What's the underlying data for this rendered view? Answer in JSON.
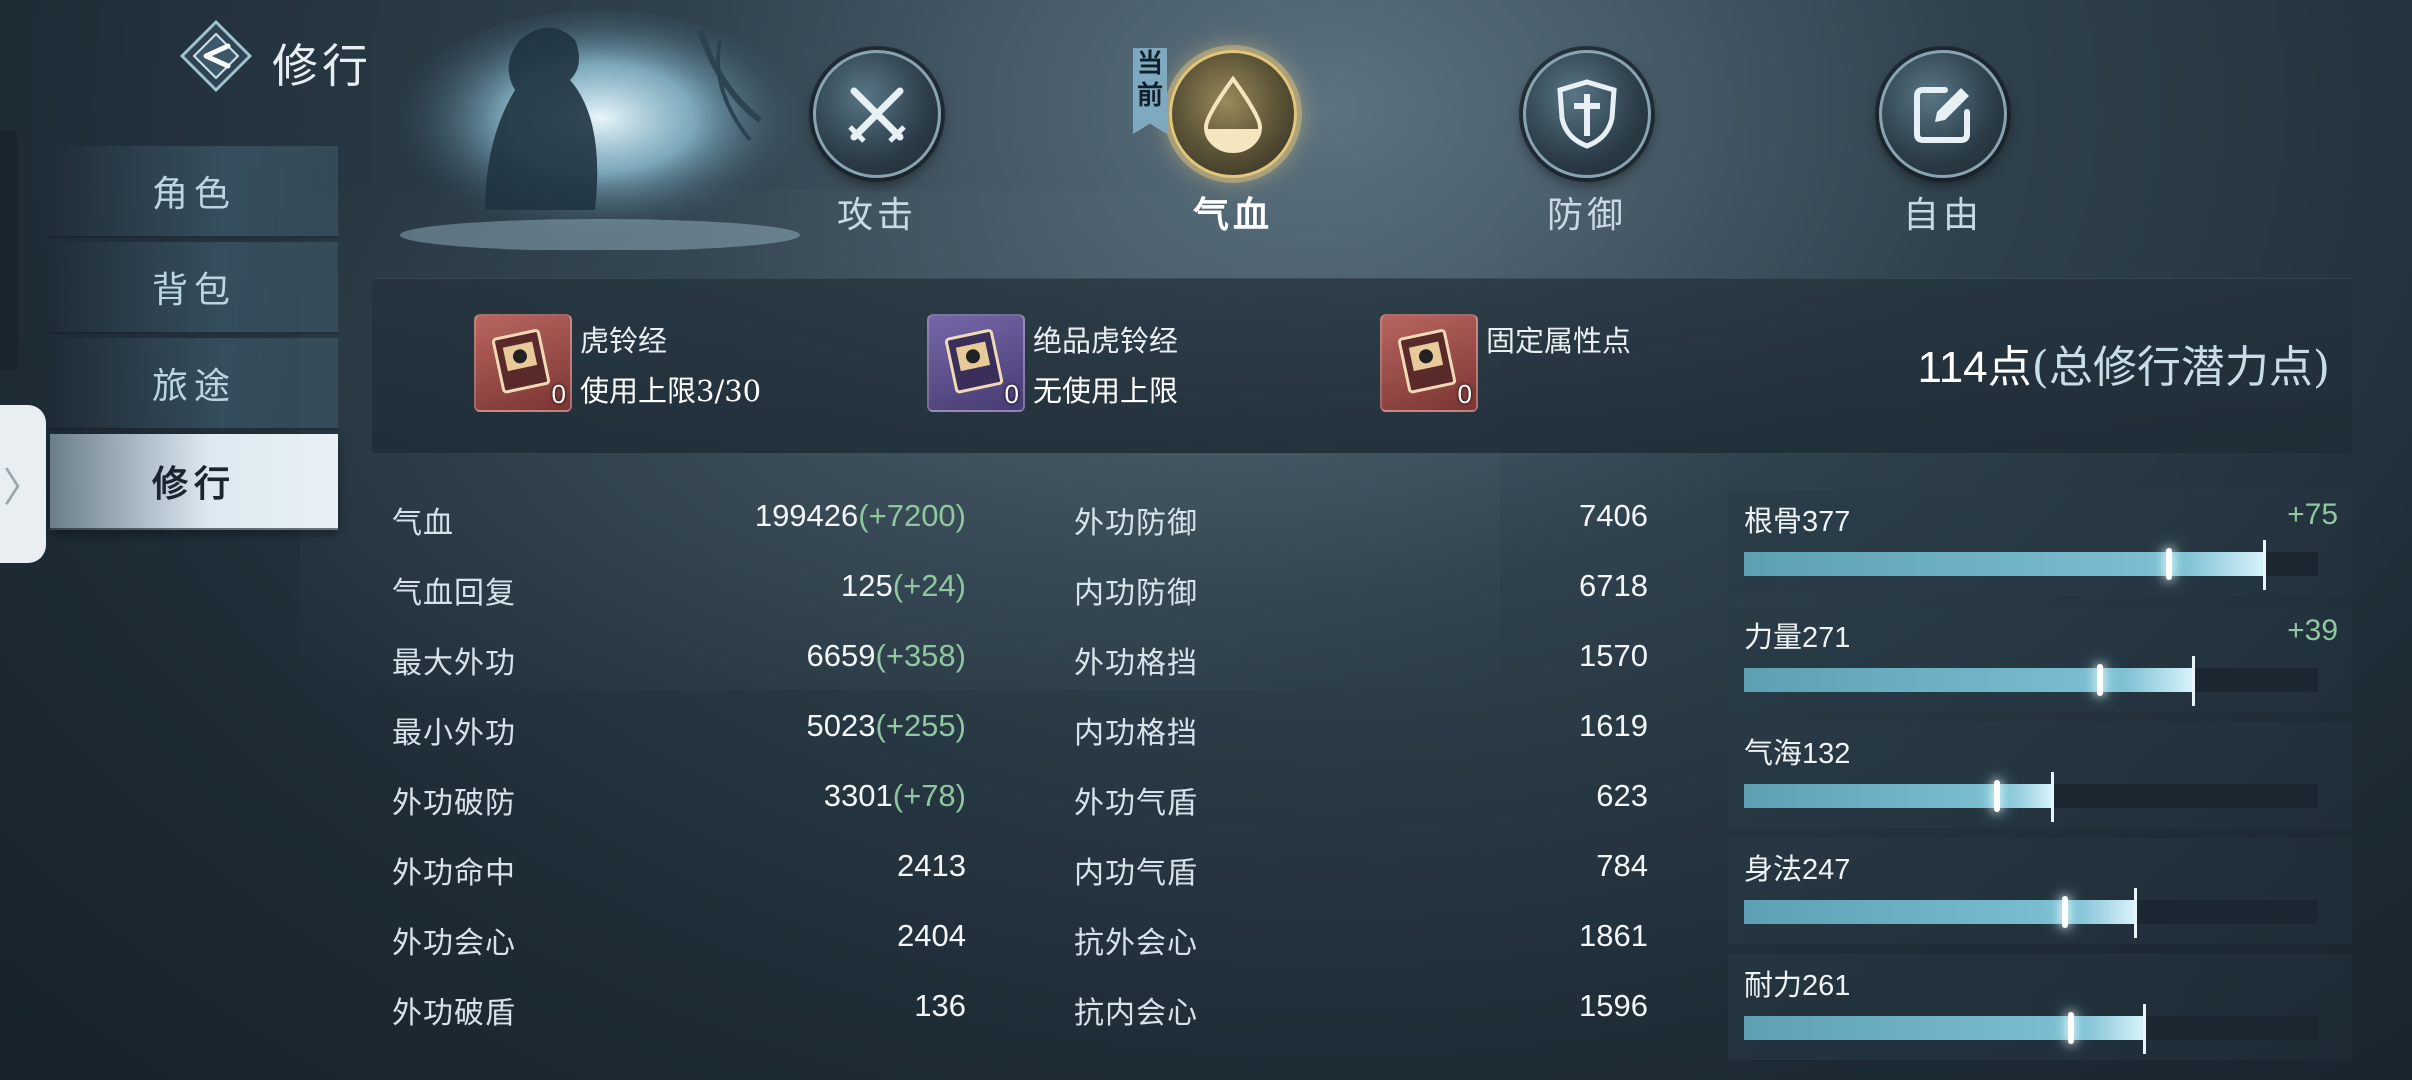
{
  "header": {
    "title": "修行"
  },
  "sidebar": {
    "items": [
      {
        "label": "角色"
      },
      {
        "label": "背包"
      },
      {
        "label": "旅途"
      },
      {
        "label": "修行"
      }
    ],
    "active_index": 3,
    "handle_glyph": "〉"
  },
  "tabs": [
    {
      "label": "攻击",
      "icon": "crossed-swords-icon"
    },
    {
      "label": "气血",
      "icon": "blood-drop-icon"
    },
    {
      "label": "防御",
      "icon": "shield-icon"
    },
    {
      "label": "自由",
      "icon": "edit-icon"
    }
  ],
  "active_tab_index": 1,
  "current_tag": "当前",
  "items": [
    {
      "name": "虎铃经",
      "limit": "使用上限3/30",
      "count": "0",
      "color": "red"
    },
    {
      "name": "绝品虎铃经",
      "limit": "无使用上限",
      "count": "0",
      "color": "purple"
    },
    {
      "name": "固定属性点",
      "limit": "",
      "count": "0",
      "color": "red"
    }
  ],
  "potential": {
    "value": "114点",
    "suffix": "(总修行潜力点)"
  },
  "stats_left": [
    {
      "label": "气血",
      "value": "199426",
      "bonus": "(+7200)"
    },
    {
      "label": "气血回复",
      "value": "125",
      "bonus": "(+24)"
    },
    {
      "label": "最大外功",
      "value": "6659",
      "bonus": "(+358)"
    },
    {
      "label": "最小外功",
      "value": "5023",
      "bonus": "(+255)"
    },
    {
      "label": "外功破防",
      "value": "3301",
      "bonus": "(+78)"
    },
    {
      "label": "外功命中",
      "value": "2413",
      "bonus": ""
    },
    {
      "label": "外功会心",
      "value": "2404",
      "bonus": ""
    },
    {
      "label": "外功破盾",
      "value": "136",
      "bonus": ""
    }
  ],
  "stats_right": [
    {
      "label": "外功防御",
      "value": "7406"
    },
    {
      "label": "内功防御",
      "value": "6718"
    },
    {
      "label": "外功格挡",
      "value": "1570"
    },
    {
      "label": "内功格挡",
      "value": "1619"
    },
    {
      "label": "外功气盾",
      "value": "623"
    },
    {
      "label": "内功气盾",
      "value": "784"
    },
    {
      "label": "抗外会心",
      "value": "1861"
    },
    {
      "label": "抗内会心",
      "value": "1596"
    }
  ],
  "attributes": [
    {
      "name": "根骨",
      "value": "377",
      "delta": "+75",
      "base_fraction": 0.74,
      "total_fraction": 0.905
    },
    {
      "name": "力量",
      "value": "271",
      "delta": "+39",
      "base_fraction": 0.62,
      "total_fraction": 0.78
    },
    {
      "name": "气海",
      "value": "132",
      "delta": "",
      "base_fraction": 0.44,
      "total_fraction": 0.535
    },
    {
      "name": "身法",
      "value": "247",
      "delta": "",
      "base_fraction": 0.56,
      "total_fraction": 0.68
    },
    {
      "name": "耐力",
      "value": "261",
      "delta": "",
      "base_fraction": 0.57,
      "total_fraction": 0.695
    }
  ],
  "colors": {
    "accent": "#7ec0d3",
    "bonus": "#8fc7a0",
    "gold": "#e4c67a"
  }
}
